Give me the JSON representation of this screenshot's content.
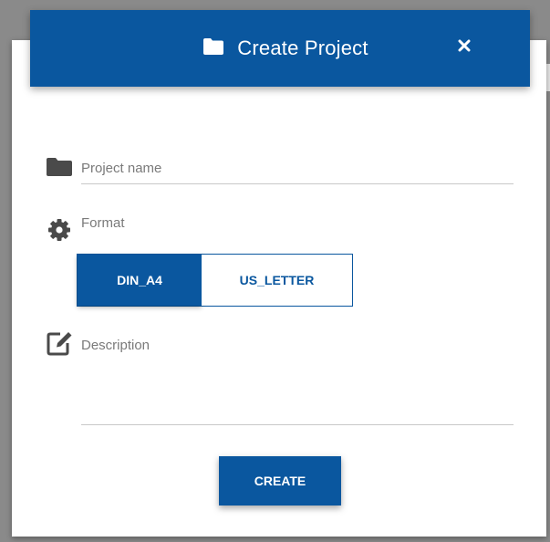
{
  "dialog": {
    "title": "Create Project",
    "title_icon": "folder-icon",
    "close_icon": "close-icon",
    "close_glyph": "✕"
  },
  "fields": {
    "project_name": {
      "placeholder": "Project name",
      "icon": "folder-icon",
      "value": ""
    },
    "format": {
      "label": "Format",
      "icon": "gear-icon",
      "options": [
        "DIN_A4",
        "US_LETTER"
      ],
      "selected": "DIN_A4"
    },
    "description": {
      "placeholder": "Description",
      "icon": "edit-icon",
      "value": ""
    }
  },
  "actions": {
    "create_label": "CREATE"
  },
  "colors": {
    "accent": "#0a579f",
    "label": "#7a7a7a",
    "icon": "#4a4a4a"
  }
}
